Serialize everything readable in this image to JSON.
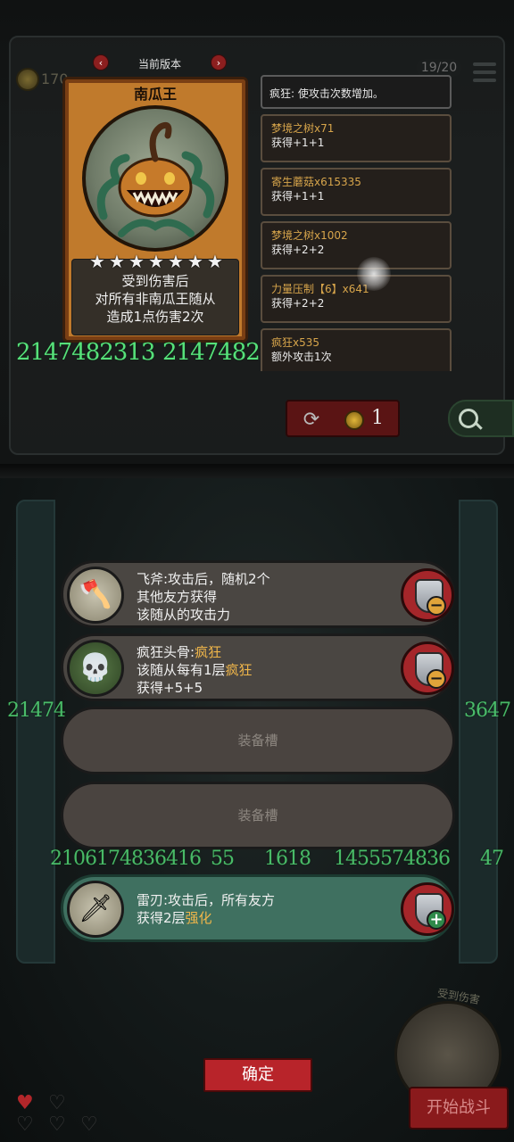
{
  "top": {
    "coin_amount": "170",
    "slot_counter": "19/20",
    "version_label": "当前版本",
    "prev_arrow": "‹",
    "next_arrow": "›"
  },
  "card": {
    "name": "南瓜王",
    "stars": [
      "★",
      "★",
      "★",
      "★",
      "★",
      "★",
      "★"
    ],
    "desc_lines": [
      "受到伤害后",
      "对所有非南瓜王随从",
      "造成1点伤害2次"
    ],
    "attack": "2147482313",
    "health": "2147482"
  },
  "info": {
    "header": "疯狂: 使攻击次数增加。",
    "items": [
      {
        "name": "梦境之树x71",
        "sub": "获得+1+1"
      },
      {
        "name": "寄生蘑菇x615335",
        "sub": "获得+1+1"
      },
      {
        "name": "梦境之树x1002",
        "sub": "获得+2+2"
      },
      {
        "name": "力量压制【6】x641",
        "sub": "获得+2+2"
      },
      {
        "name": "疯狂x535",
        "sub": "额外攻击1次"
      }
    ]
  },
  "refresh": {
    "icon": "⟳",
    "cost": "1"
  },
  "equipment": {
    "slots": [
      {
        "lines": [
          [
            "飞斧:攻击后，随机2个",
            ""
          ],
          [
            "其他友方获得",
            ""
          ],
          [
            "该随从的攻击力",
            ""
          ]
        ],
        "icon": "axe-icon",
        "glyph": "🪓",
        "action": "−"
      },
      {
        "lines": [
          [
            "疯狂头骨:",
            "疯狂"
          ],
          [
            "该随从每有1层",
            "疯狂"
          ],
          [
            "获得+5+5",
            ""
          ]
        ],
        "icon": "skull-icon",
        "glyph": "💀",
        "action": "−"
      },
      {
        "empty_label": "装备槽"
      },
      {
        "empty_label": "装备槽"
      },
      {
        "lines": [
          [
            "雷刃:攻击后，所有友方",
            ""
          ],
          [
            "获得2层",
            "强化"
          ]
        ],
        "icon": "blade-icon",
        "glyph": "🗡",
        "action": "+"
      }
    ]
  },
  "overlay_numbers": {
    "row1": "21474",
    "row1_right": "3647",
    "row2_a": "2106174836416",
    "row2_b": "55",
    "row2_c": "1618",
    "row2_d": "1455574836",
    "row2_e": "47"
  },
  "confirm_label": "确定",
  "start_label": "开始战斗",
  "start_card_label": "受到伤害"
}
